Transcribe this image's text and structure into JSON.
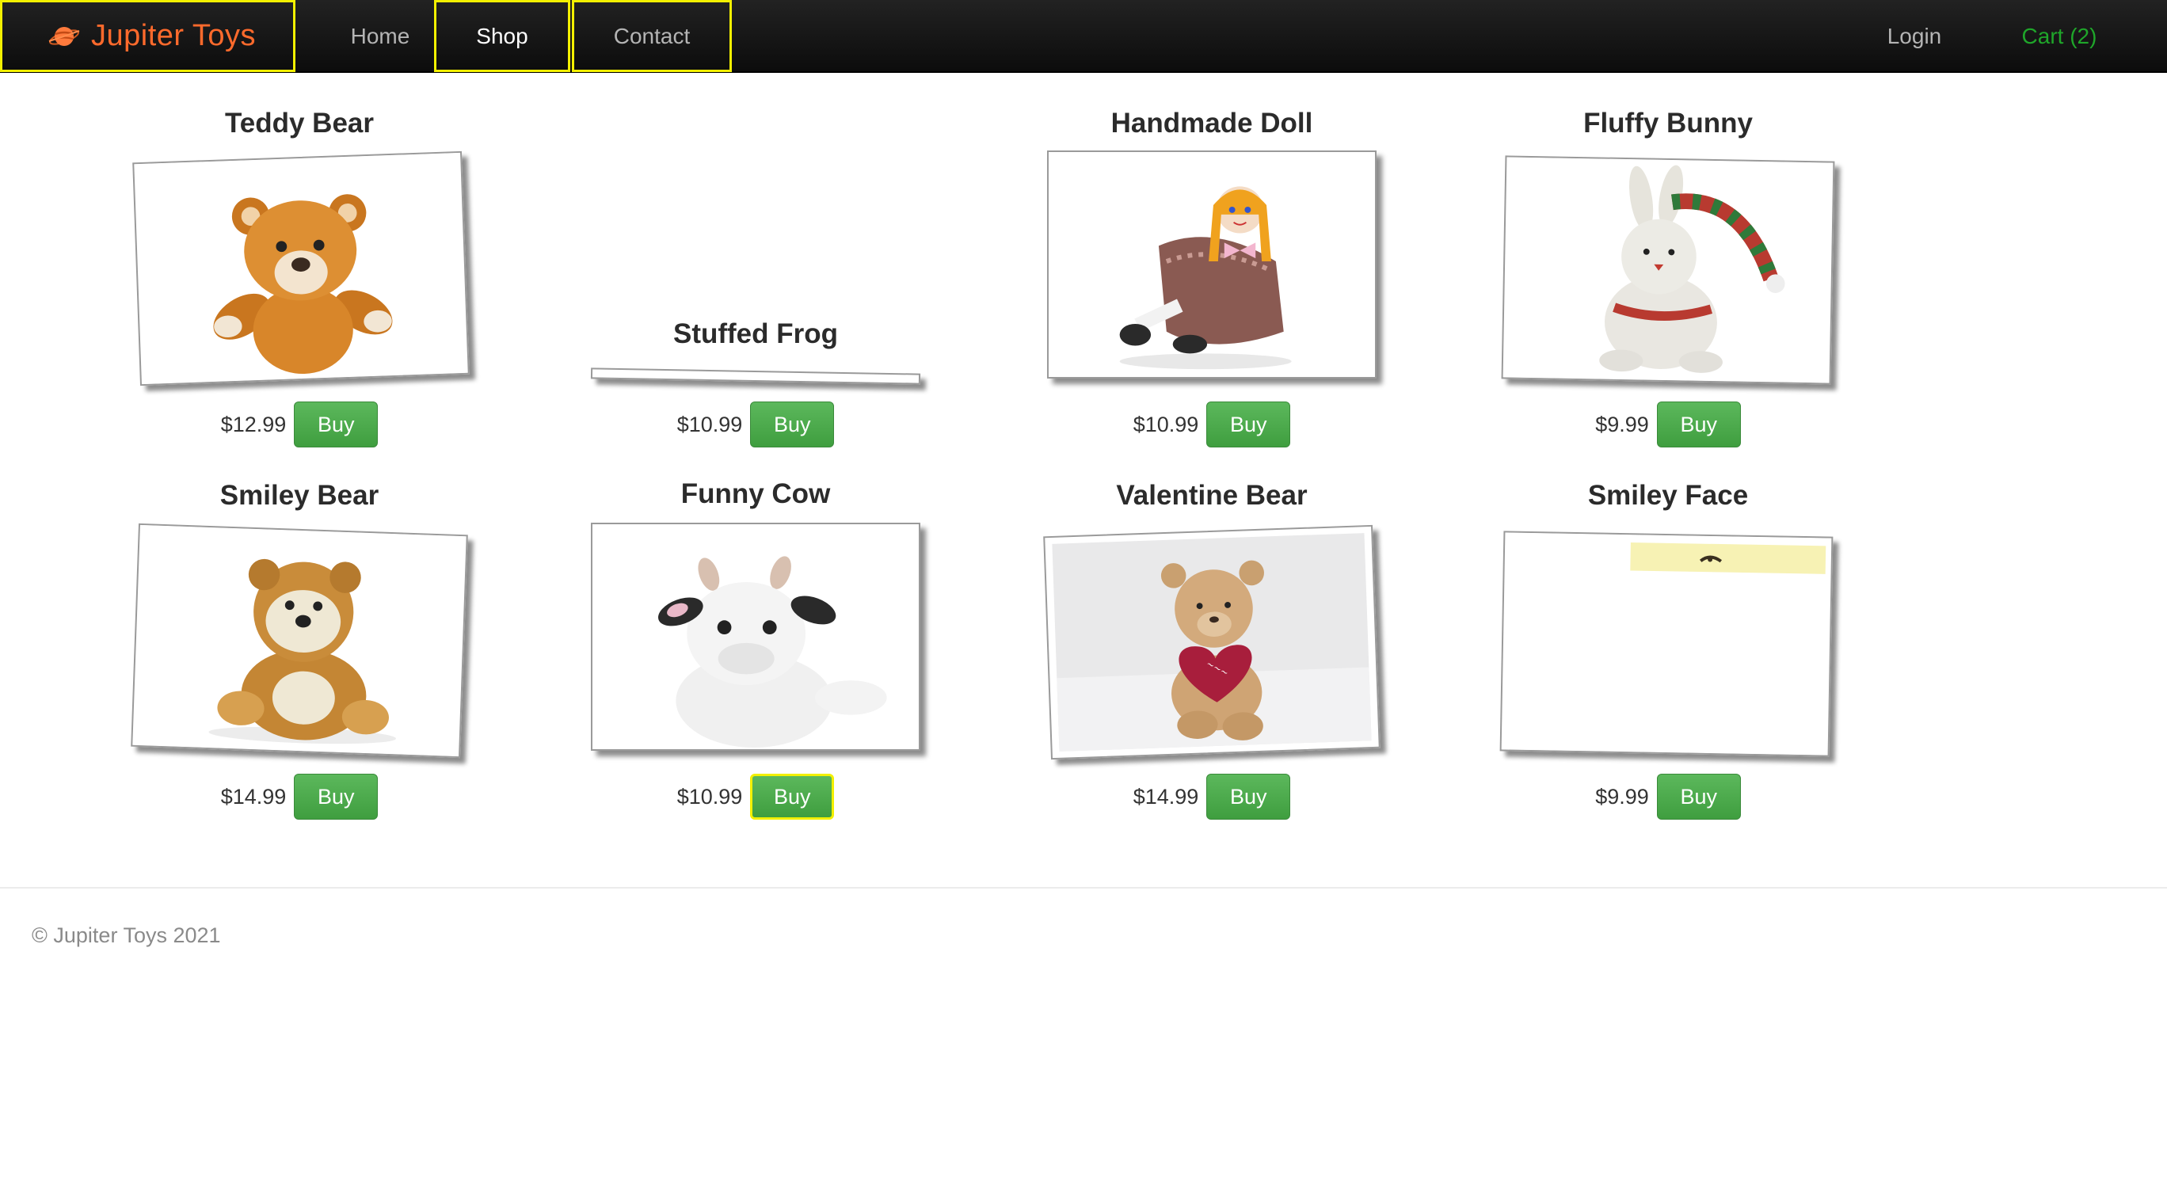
{
  "nav": {
    "brand": "Jupiter Toys",
    "home": "Home",
    "shop": "Shop",
    "contact": "Contact",
    "login": "Login",
    "cart": "Cart (2)"
  },
  "products": [
    {
      "title": "Teddy Bear",
      "price": "$12.99",
      "buy": "Buy"
    },
    {
      "title": "Stuffed Frog",
      "price": "$10.99",
      "buy": "Buy"
    },
    {
      "title": "Handmade Doll",
      "price": "$10.99",
      "buy": "Buy"
    },
    {
      "title": "Fluffy Bunny",
      "price": "$9.99",
      "buy": "Buy"
    },
    {
      "title": "Smiley Bear",
      "price": "$14.99",
      "buy": "Buy"
    },
    {
      "title": "Funny Cow",
      "price": "$10.99",
      "buy": "Buy"
    },
    {
      "title": "Valentine Bear",
      "price": "$14.99",
      "buy": "Buy"
    },
    {
      "title": "Smiley Face",
      "price": "$9.99",
      "buy": "Buy"
    }
  ],
  "footer": {
    "copyright": "© Jupiter Toys 2021"
  },
  "colors": {
    "brand": "#ff6a2c",
    "cart": "#1fa62a",
    "buy_button": "#5cb85c",
    "focus_outline": "#f3f000"
  }
}
